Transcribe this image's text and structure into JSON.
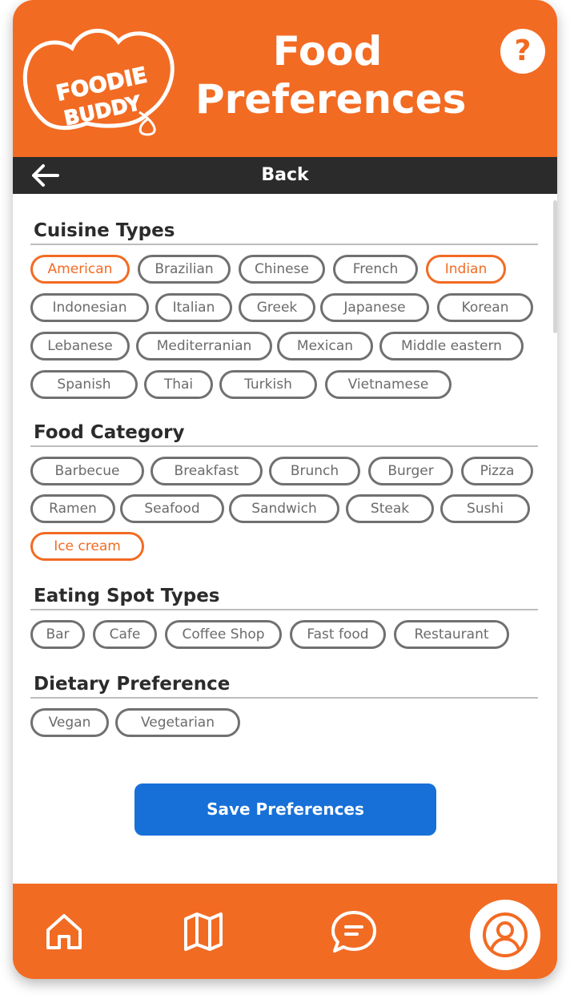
{
  "app": {
    "logo_line1": "FOODIE",
    "logo_line2": "BUDDY",
    "title_line1": "Food",
    "title_line2": "Preferences",
    "help_label": "?",
    "back_label": "Back",
    "accent_color": "#f26b23",
    "button_color": "#1770d8"
  },
  "sections": [
    {
      "title": "Cuisine Types",
      "chips": [
        {
          "label": "American",
          "selected": true
        },
        {
          "label": "Brazilian",
          "selected": false
        },
        {
          "label": "Chinese",
          "selected": false
        },
        {
          "label": "French",
          "selected": false
        },
        {
          "label": "Indian",
          "selected": true
        },
        {
          "label": "Indonesian",
          "selected": false
        },
        {
          "label": "Italian",
          "selected": false
        },
        {
          "label": "Greek",
          "selected": false
        },
        {
          "label": "Japanese",
          "selected": false
        },
        {
          "label": "Korean",
          "selected": false
        },
        {
          "label": "Lebanese",
          "selected": false
        },
        {
          "label": "Mediterranian",
          "selected": false
        },
        {
          "label": "Mexican",
          "selected": false
        },
        {
          "label": "Middle eastern",
          "selected": false
        },
        {
          "label": "Spanish",
          "selected": false
        },
        {
          "label": "Thai",
          "selected": false
        },
        {
          "label": "Turkish",
          "selected": false
        },
        {
          "label": "Vietnamese",
          "selected": false
        }
      ]
    },
    {
      "title": "Food Category",
      "chips": [
        {
          "label": "Barbecue",
          "selected": false
        },
        {
          "label": "Breakfast",
          "selected": false
        },
        {
          "label": "Brunch",
          "selected": false
        },
        {
          "label": "Burger",
          "selected": false
        },
        {
          "label": "Pizza",
          "selected": false
        },
        {
          "label": "Ramen",
          "selected": false
        },
        {
          "label": "Seafood",
          "selected": false
        },
        {
          "label": "Sandwich",
          "selected": false
        },
        {
          "label": "Steak",
          "selected": false
        },
        {
          "label": "Sushi",
          "selected": false
        },
        {
          "label": "Ice cream",
          "selected": true
        }
      ]
    },
    {
      "title": "Eating Spot Types",
      "chips": [
        {
          "label": "Bar",
          "selected": false
        },
        {
          "label": "Cafe",
          "selected": false
        },
        {
          "label": "Coffee Shop",
          "selected": false
        },
        {
          "label": "Fast food",
          "selected": false
        },
        {
          "label": "Restaurant",
          "selected": false
        }
      ]
    },
    {
      "title": "Dietary Preference",
      "chips": [
        {
          "label": "Vegan",
          "selected": false
        },
        {
          "label": "Vegetarian",
          "selected": false
        }
      ]
    }
  ],
  "save_button": "Save Preferences",
  "nav": [
    {
      "icon": "home-icon"
    },
    {
      "icon": "map-icon"
    },
    {
      "icon": "chat-icon"
    },
    {
      "icon": "profile-icon",
      "active": true
    }
  ]
}
